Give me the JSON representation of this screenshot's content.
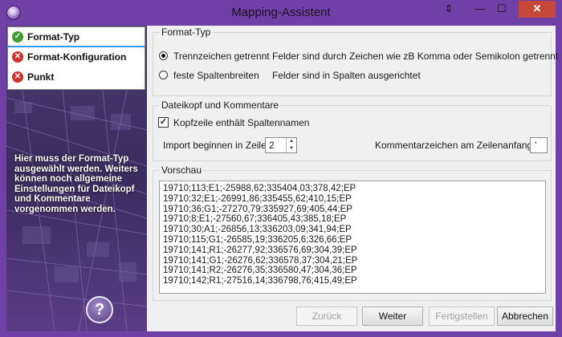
{
  "window": {
    "title": "Mapping-Assistent",
    "close_glyph": "✕",
    "min_glyph": "—",
    "max_glyph": "☐",
    "resize_glyph": "⇕"
  },
  "steps": [
    {
      "label": "Format-Typ",
      "status": "ok",
      "icon": "check-icon"
    },
    {
      "label": "Format-Konfiguration",
      "status": "error",
      "icon": "error-icon"
    },
    {
      "label": "Punkt",
      "status": "error",
      "icon": "error-icon"
    }
  ],
  "help_text": "Hier muss der Format-Typ ausgewählt werden. Weiters können noch allgemeine Einstellungen für Dateikopf und Kommentare vorgenommen werden.",
  "format_group": {
    "title": "Format-Typ",
    "options": [
      {
        "label": "Trennzeichen getrennt",
        "description": "Felder sind durch Zeichen wie zB Komma oder Semikolon getrennt",
        "selected": true
      },
      {
        "label": "feste Spaltenbreiten",
        "description": "Felder sind in Spalten ausgerichtet",
        "selected": false
      }
    ]
  },
  "header_group": {
    "title": "Dateikopf und Kommentare",
    "header_checkbox_label": "Kopfzeile enthält Spaltennamen",
    "header_checked": true,
    "check_glyph": "✓",
    "import_start_label": "Import beginnen in Zeile:",
    "import_start_value": "2",
    "spin_up": "▲",
    "spin_down": "▼",
    "comment_label": "Kommentarzeichen am Zeilenanfang:",
    "comment_value": "'"
  },
  "preview": {
    "title": "Vorschau",
    "lines": [
      "19710;113;E1;-25988,62;335404,03;378,42;EP",
      "19710;32;E1;-26991,86;335455,62;410,15;EP",
      "19710;36;G1;-27270,79;335927,69;405,44;EP",
      "19710;8;E1;-27560,67;336405,43;385,18;EP",
      "19710;30;A1;-26856,13;336203,09;341,94;EP",
      "19710;115;G1;-26585,19;336205,6;326,66;EP",
      "19710;141;R1;-26277,92;336576,69;304,39;EP",
      "19710;141;G1;-26276,62;336578,37;304,21;EP",
      "19710;141;R2;-26276,35;336580,47;304,36;EP",
      "19710;142;R1;-27516,14;336798,76;415,49;EP"
    ]
  },
  "buttons": {
    "back": "Zurück",
    "next": "Weiter",
    "finish": "Fertigstellen",
    "cancel": "Abbrechen"
  },
  "help_glyph": "?",
  "colors": {
    "accent": "#6f41a6",
    "ok": "#3f9d2f",
    "error": "#d0312d",
    "close": "#c7483a"
  }
}
